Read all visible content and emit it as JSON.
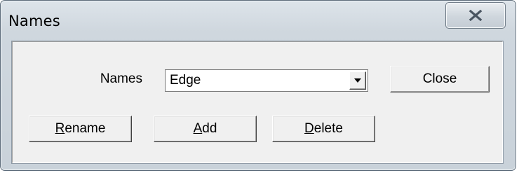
{
  "window": {
    "title": "Names"
  },
  "form": {
    "names_label": "Names",
    "names_value": "Edge"
  },
  "buttons": {
    "close": "Close",
    "rename": {
      "mnemonic": "R",
      "rest": "ename"
    },
    "add": {
      "mnemonic": "A",
      "rest": "dd"
    },
    "delete": {
      "mnemonic": "D",
      "rest": "elete"
    }
  },
  "icons": {
    "titlebar_close": "close-icon",
    "combo_arrow": "chevron-down-icon"
  }
}
